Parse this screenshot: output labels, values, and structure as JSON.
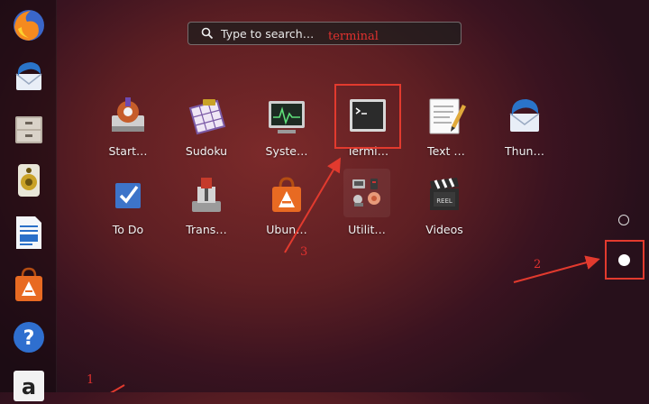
{
  "dock": {
    "items": [
      {
        "name": "firefox-icon"
      },
      {
        "name": "thunderbird-icon"
      },
      {
        "name": "files-icon"
      },
      {
        "name": "rhythmbox-icon"
      },
      {
        "name": "writer-icon"
      },
      {
        "name": "ubuntu-software-icon"
      },
      {
        "name": "help-icon"
      },
      {
        "name": "amazon-icon"
      }
    ]
  },
  "search": {
    "placeholder": "Type to search…",
    "typed_annotation": "terminal"
  },
  "apps": [
    {
      "label": "Start…",
      "icon": "startup-disk-creator-icon"
    },
    {
      "label": "Sudoku",
      "icon": "sudoku-icon"
    },
    {
      "label": "Syste…",
      "icon": "system-monitor-icon"
    },
    {
      "label": "Termi…",
      "icon": "terminal-icon"
    },
    {
      "label": "Text …",
      "icon": "text-editor-icon"
    },
    {
      "label": "Thun…",
      "icon": "thunderbird-icon"
    },
    {
      "label": "To Do",
      "icon": "todo-icon"
    },
    {
      "label": "Trans…",
      "icon": "transmission-icon"
    },
    {
      "label": "Ubun…",
      "icon": "ubuntu-software-icon"
    },
    {
      "label": "Utilit…",
      "icon": "utilities-folder-icon"
    },
    {
      "label": "Videos",
      "icon": "videos-icon"
    }
  ],
  "annotations": {
    "step1": "1",
    "step2": "2",
    "step3": "3"
  },
  "colors": {
    "annotation_red": "#e23a2e",
    "background": "#5e1f23"
  }
}
